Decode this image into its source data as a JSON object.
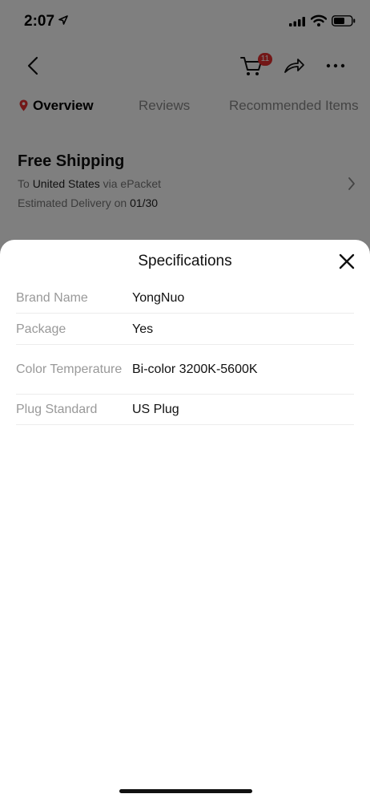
{
  "status_bar": {
    "time": "2:07"
  },
  "nav": {
    "cart_count": "11"
  },
  "tabs": [
    {
      "label": "Overview"
    },
    {
      "label": "Reviews"
    },
    {
      "label": "Recommended Items"
    }
  ],
  "shipping": {
    "title": "Free Shipping",
    "to_prefix": "To",
    "country": "United States",
    "via": "via ePacket",
    "delivery_prefix": "Estimated Delivery on",
    "delivery_date": "01/30"
  },
  "sheet": {
    "title": "Specifications",
    "specs": [
      {
        "key": "Brand Name",
        "value": "YongNuo"
      },
      {
        "key": "Package",
        "value": "Yes"
      },
      {
        "key": "Color Temperature",
        "value": "Bi-color 3200K-5600K"
      },
      {
        "key": "Plug Standard",
        "value": "US Plug"
      }
    ]
  },
  "colors": {
    "accent": "#e62e2e",
    "overlay": "rgba(0,0,0,0.5)"
  }
}
